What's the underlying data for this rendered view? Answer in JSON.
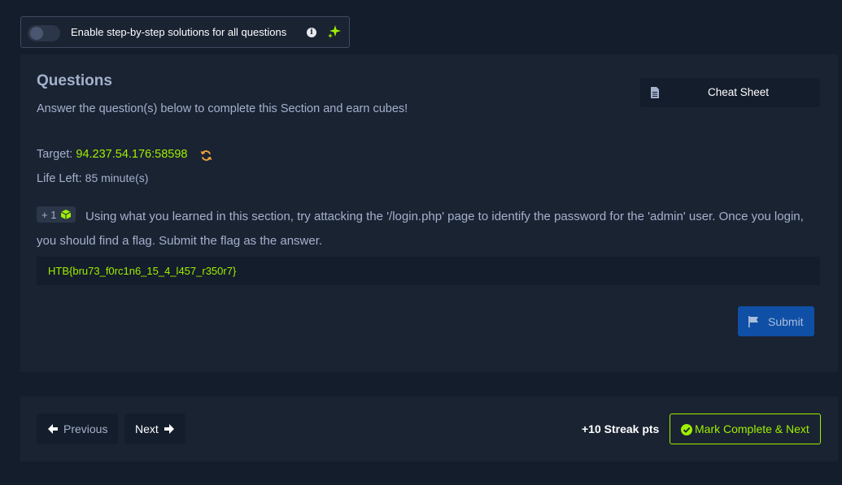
{
  "settings": {
    "step_by_step_label": "Enable step-by-step solutions for all questions",
    "step_by_step_enabled": false,
    "info_icon": "info-icon",
    "sparkle_icon": "sparkle-icon"
  },
  "section": {
    "title": "Questions",
    "subtitle": "Answer the question(s) below to complete this Section and earn cubes!",
    "cheat_sheet_label": "Cheat Sheet"
  },
  "target": {
    "label": "Target:",
    "value": "94.237.54.176:58598",
    "life_label": "Life Left:",
    "life_value": "85 minute(s)"
  },
  "question": {
    "reward": "+ 1",
    "text": "Using what you learned in this section, try attacking the '/login.php' page to identify the password for the 'admin' user. Once you login, you should find a flag. Submit the flag as the answer.",
    "answer_value": "HTB{bru73_f0rc1n6_15_4_l457_r350r7}",
    "submit_label": "Submit"
  },
  "nav": {
    "previous_label": "Previous",
    "next_label": "Next",
    "streak_label": "+10 Streak pts",
    "mark_complete_label": "Mark Complete & Next"
  },
  "colors": {
    "background": "#141d2b",
    "card": "#1a2332",
    "accent_green": "#9fef00",
    "submit_blue": "#0f4fa5"
  }
}
